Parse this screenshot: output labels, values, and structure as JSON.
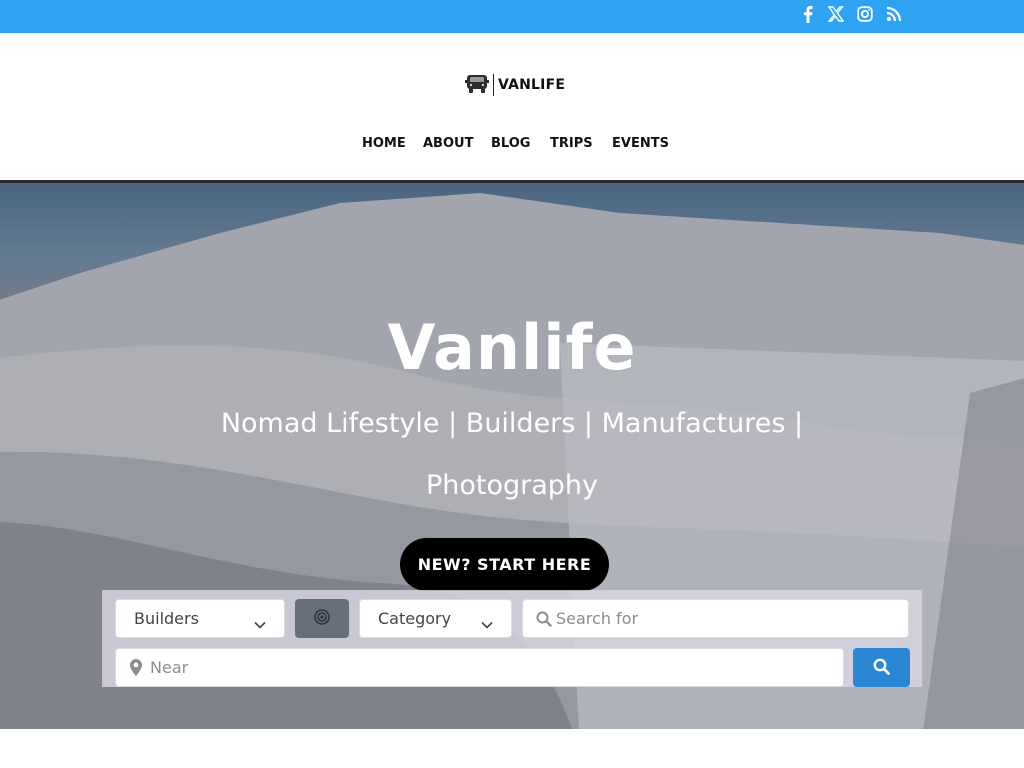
{
  "topbar": {
    "color": "#2ea3f2",
    "social_icons": [
      "facebook-icon",
      "x-icon",
      "instagram-icon",
      "rss-icon"
    ]
  },
  "header": {
    "logo_text": "VANLIFE",
    "nav": [
      "HOME",
      "ABOUT",
      "BLOG",
      "TRIPS",
      "EVENTS"
    ]
  },
  "hero": {
    "title": "Vanlife",
    "subtitle_line1": "Nomad Lifestyle | Builders | Manufactures |",
    "subtitle_line2": "Photography",
    "cta_label": "NEW? START HERE"
  },
  "search": {
    "type_select": "Builders",
    "category_select": "Category",
    "search_placeholder": "Search for",
    "near_placeholder": "Near",
    "button_color": "#2b87d3"
  }
}
